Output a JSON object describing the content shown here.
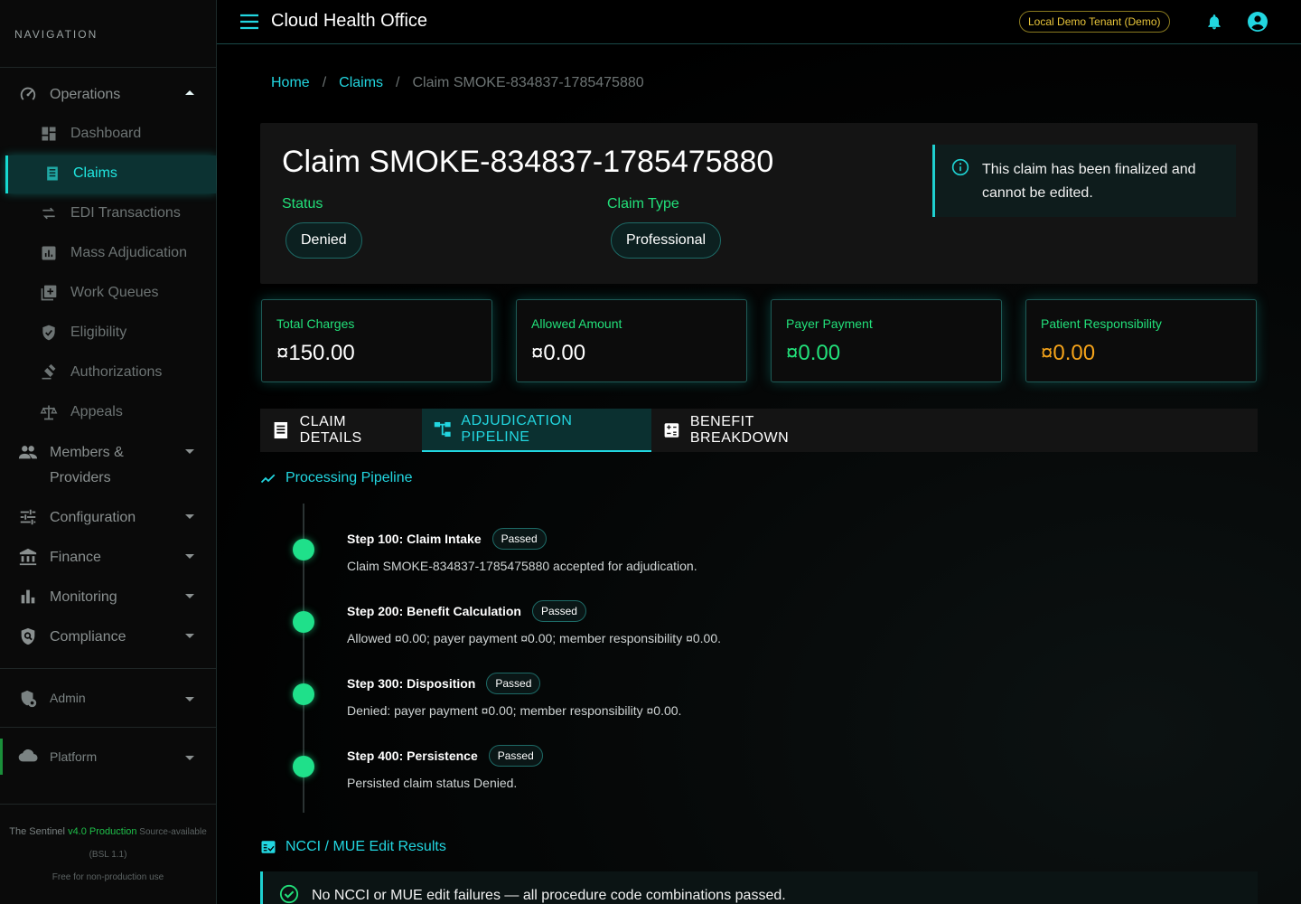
{
  "sidebar": {
    "heading": "NAVIGATION",
    "groups": {
      "operations": "Operations",
      "members": "Members &",
      "members2": "Providers",
      "configuration": "Configuration",
      "finance": "Finance",
      "monitoring": "Monitoring",
      "compliance": "Compliance",
      "admin": "Admin",
      "platform": "Platform"
    },
    "items": [
      {
        "label": "Dashboard"
      },
      {
        "label": "Claims"
      },
      {
        "label": "EDI Transactions"
      },
      {
        "label": "Mass Adjudication"
      },
      {
        "label": "Work Queues"
      },
      {
        "label": "Eligibility"
      },
      {
        "label": "Authorizations"
      },
      {
        "label": "Appeals"
      }
    ],
    "footer": {
      "line1_prefix": "The Sentinel ",
      "version": "v4.0 Production",
      "line1_suffix": " Source-available (BSL 1.1)",
      "line2": "Free for non-production use"
    }
  },
  "topbar": {
    "title": "Cloud Health Office",
    "tenant": "Local Demo Tenant (Demo)"
  },
  "breadcrumb": {
    "home": "Home",
    "claims": "Claims",
    "current": "Claim SMOKE-834837-1785475880",
    "sep": "/"
  },
  "claim": {
    "title": "Claim SMOKE-834837-1785475880",
    "status_label": "Status",
    "status": "Denied",
    "type_label": "Claim Type",
    "type": "Professional",
    "info": "This claim has been finalized and cannot be edited."
  },
  "stats": [
    {
      "label": "Total Charges",
      "value": "¤150.00"
    },
    {
      "label": "Allowed Amount",
      "value": "¤0.00"
    },
    {
      "label": "Payer Payment",
      "value": "¤0.00"
    },
    {
      "label": "Patient Responsibility",
      "value": "¤0.00"
    }
  ],
  "tabs": [
    {
      "label": "CLAIM DETAILS"
    },
    {
      "label": "ADJUDICATION PIPELINE"
    },
    {
      "label": "BENEFIT BREAKDOWN"
    }
  ],
  "pipeline": {
    "title": "Processing Pipeline",
    "steps": [
      {
        "title": "Step 100: Claim Intake",
        "status": "Passed",
        "desc": "Claim SMOKE-834837-1785475880 accepted for adjudication."
      },
      {
        "title": "Step 200: Benefit Calculation",
        "status": "Passed",
        "desc": "Allowed ¤0.00; payer payment ¤0.00; member responsibility ¤0.00."
      },
      {
        "title": "Step 300: Disposition",
        "status": "Passed",
        "desc": "Denied: payer payment ¤0.00; member responsibility ¤0.00."
      },
      {
        "title": "Step 400: Persistence",
        "status": "Passed",
        "desc": "Persisted claim status Denied."
      }
    ]
  },
  "ncci": {
    "title": "NCCI / MUE Edit Results",
    "message": "No NCCI or MUE edit failures — all procedure code combinations passed."
  },
  "colors": {
    "accent": "#22d6e0",
    "green": "#22e07a",
    "orange": "#f5a31a"
  }
}
